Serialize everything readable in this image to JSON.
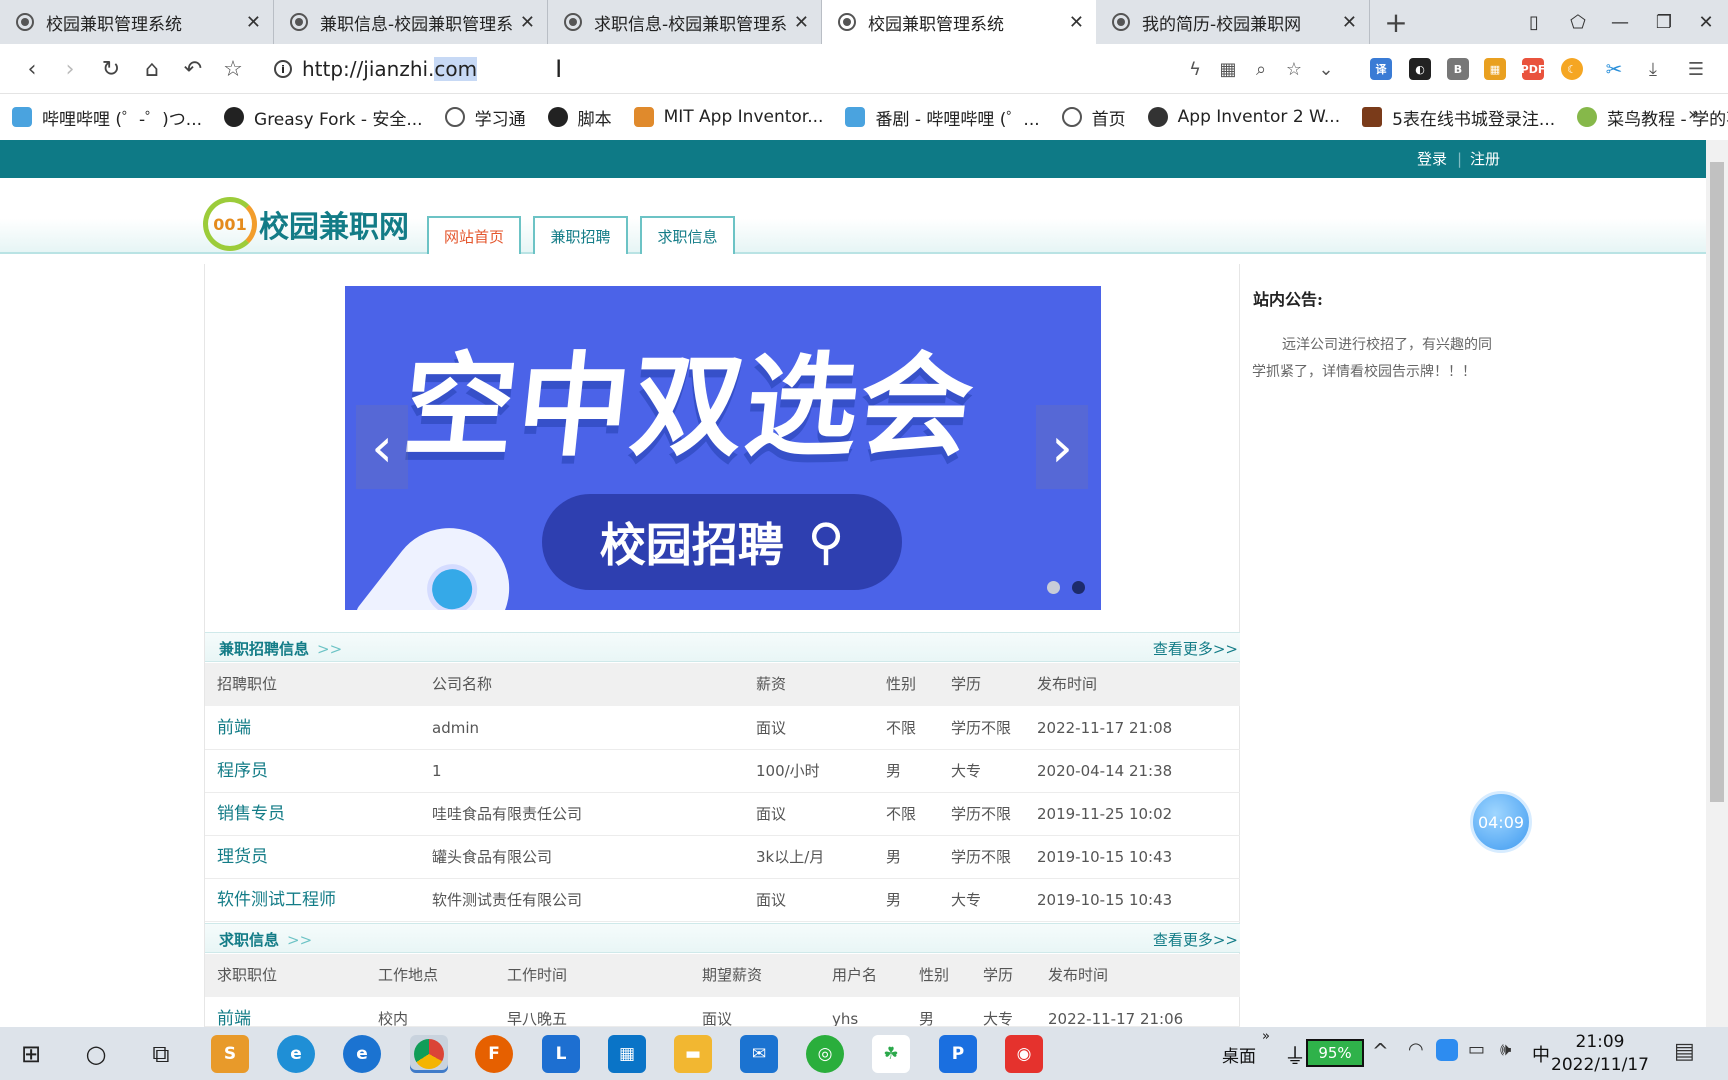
{
  "browser": {
    "tabs": [
      {
        "title": "校园兼职管理系统",
        "active": false
      },
      {
        "title": "兼职信息-校园兼职管理系",
        "active": false
      },
      {
        "title": "求职信息-校园兼职管理系",
        "active": false
      },
      {
        "title": "校园兼职管理系统",
        "active": true
      },
      {
        "title": "我的简历-校园兼职网",
        "active": false
      }
    ],
    "url_prefix": "http://jianzhi.",
    "url_selected": "com",
    "bookmarks": [
      {
        "label": "哔哩哔哩 (゜-゜)つ...",
        "color": "#4aa3df"
      },
      {
        "label": "Greasy Fork - 安全...",
        "color": "#222222"
      },
      {
        "label": "学习通",
        "color": "#555555"
      },
      {
        "label": "脚本",
        "color": "#222222"
      },
      {
        "label": "MIT App Inventor...",
        "color": "#e08a2c"
      },
      {
        "label": "番剧 - 哔哩哔哩 (゜...",
        "color": "#4aa3df"
      },
      {
        "label": "首页",
        "color": "#555555"
      },
      {
        "label": "App Inventor 2 W...",
        "color": "#333333"
      },
      {
        "label": "5表在线书城登录注...",
        "color": "#7a3b1a"
      },
      {
        "label": "菜鸟教程 - 学的不...",
        "color": "#86b84a"
      }
    ],
    "bookmarks_more": "»"
  },
  "site": {
    "top_links": {
      "login": "登录",
      "divider": "|",
      "register": "注册"
    },
    "logo_badge": "001",
    "logo_text": "校园兼职网",
    "nav": [
      "网站首页",
      "兼职招聘",
      "求职信息"
    ],
    "banner": {
      "headline": "空中双选会",
      "pill": "校园招聘",
      "prev": "‹",
      "next": "›"
    },
    "notice": {
      "title": "站内公告:",
      "body": "远洋公司进行校招了，有兴趣的同学抓紧了，详情看校园告示牌！！！"
    },
    "jobs": {
      "title": "兼职招聘信息",
      "more": "查看更多>>",
      "headers": [
        "招聘职位",
        "公司名称",
        "薪资",
        "性别",
        "学历",
        "发布时间"
      ],
      "rows": [
        [
          "前端",
          "admin",
          "面议",
          "不限",
          "学历不限",
          "2022-11-17 21:08"
        ],
        [
          "程序员",
          "1",
          "100/小时",
          "男",
          "大专",
          "2020-04-14 21:38"
        ],
        [
          "销售专员",
          "哇哇食品有限责任公司",
          "面议",
          "不限",
          "学历不限",
          "2019-11-25 10:02"
        ],
        [
          "理货员",
          "罐头食品有限公司",
          "3k以上/月",
          "男",
          "学历不限",
          "2019-10-15 10:43"
        ],
        [
          "软件测试工程师",
          "软件测试责任有限公司",
          "面议",
          "男",
          "大专",
          "2019-10-15 10:43"
        ]
      ]
    },
    "seekers": {
      "title": "求职信息",
      "more": "查看更多>>",
      "headers": [
        "求职职位",
        "工作地点",
        "工作时间",
        "期望薪资",
        "用户名",
        "性别",
        "学历",
        "发布时间"
      ],
      "rows": [
        [
          "前端",
          "校内",
          "早八晚五",
          "面议",
          "yhs",
          "男",
          "大专",
          "2022-11-17 21:06"
        ]
      ]
    },
    "timer": "04:09"
  },
  "taskbar": {
    "desktop_label": "桌面",
    "battery": "95%",
    "ime": "中",
    "time": "21:09",
    "date": "2022/11/17"
  },
  "colors": {
    "brand_teal": "#0e7a86",
    "link": "#137c87",
    "active_nav": "#e4572e"
  }
}
